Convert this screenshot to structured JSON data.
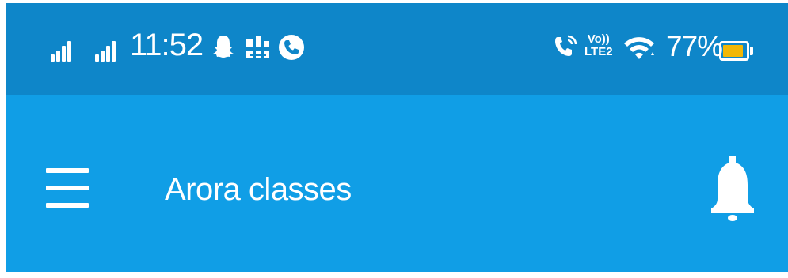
{
  "status_bar": {
    "time": "11:52",
    "battery_percent": "77%",
    "battery_level": 0.77,
    "volte": {
      "line1": "Vo))",
      "line2": "LTE2"
    },
    "icons": [
      "signal-icon",
      "signal-icon",
      "snapchat-icon",
      "notification-icon",
      "phone-icon",
      "wifi-calling-icon",
      "volte-icon",
      "wifi-icon",
      "battery-icon"
    ]
  },
  "app_bar": {
    "title": "Arora classes",
    "menu_icon": "hamburger-menu-icon",
    "notification_icon": "bell-icon"
  },
  "colors": {
    "status_bar": "#0e86c9",
    "app_bar": "#109ee6",
    "battery_fill": "#f2b705"
  }
}
